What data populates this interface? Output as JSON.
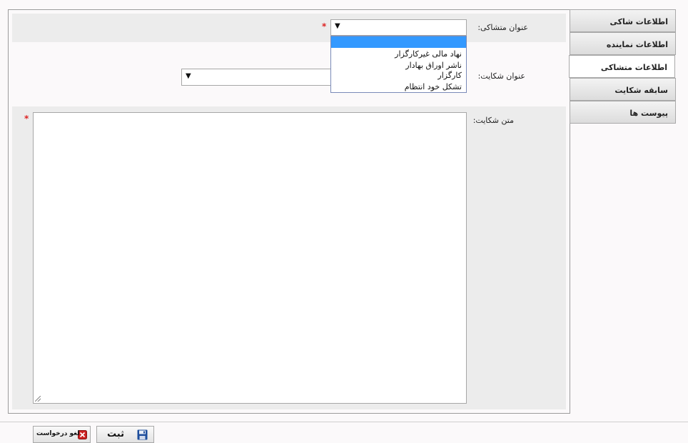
{
  "tabs": [
    {
      "label": "اطلاعات شاکی",
      "active": false
    },
    {
      "label": "اطلاعات نماینده",
      "active": false
    },
    {
      "label": "اطلاعات متشاکی",
      "active": true
    },
    {
      "label": "سابقه شکایت",
      "active": false
    },
    {
      "label": "پیوست ها",
      "active": false
    }
  ],
  "form": {
    "respondent_title_label": "عنوان متشاکی:",
    "respondent_title_value": "",
    "respondent_required_mark": "*",
    "respondent_options": [
      "",
      "نهاد مالی غیرکارگزار",
      "ناشر اوراق بهادار",
      "کارگزار",
      "تشکل خود انتظام"
    ],
    "complaint_title_label": "عنوان شکایت:",
    "complaint_title_value": "",
    "complaint_text_label": "متن شکایت:",
    "complaint_text_value": "",
    "complaint_required_mark": "*",
    "dropdown_arrow": "▼"
  },
  "footer": {
    "submit_label": "ثبت",
    "cancel_label": "لغو درخواست"
  },
  "icons": {
    "submit": "save-icon",
    "cancel": "close-icon"
  },
  "colors": {
    "highlight": "#3399ff",
    "required": "#dd2222",
    "cancel_icon": "#cc2222",
    "save_icon": "#1e4e9c"
  }
}
